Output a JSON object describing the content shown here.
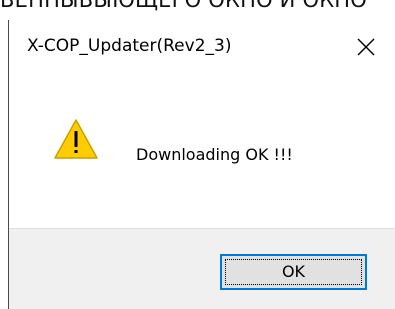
{
  "background_strip": {
    "text": "ВЕННЫВЫЮЩЕГО ОКНО И ОКНО"
  },
  "dialog": {
    "title": "X-COP_Updater(Rev2_3)",
    "close_icon": "close-icon",
    "message": "Downloading OK !!!",
    "message_icon": "warning-icon",
    "ok_label": "OK"
  },
  "colors": {
    "focus_border": "#0078d7",
    "button_face": "#e1e1e1",
    "footer_bg": "#f0f0f0",
    "warning_fill": "#ffcc00"
  }
}
